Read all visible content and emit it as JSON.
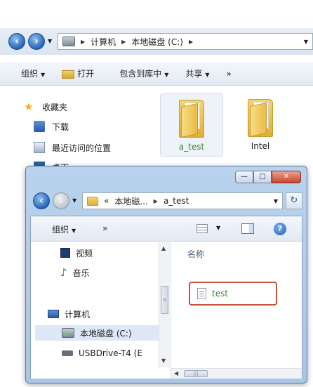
{
  "back_window": {
    "address": {
      "crumbs": [
        "计算机",
        "本地磁盘 (C:)"
      ]
    },
    "toolbar": {
      "organize": "组织",
      "open": "打开",
      "include_library": "包含到库中",
      "share": "共享",
      "more": "»"
    },
    "nav": {
      "favorites": "收藏夹",
      "downloads": "下载",
      "recent": "最近访问的位置",
      "desktop": "桌面"
    },
    "files": [
      {
        "name": "a_test",
        "selected": true
      },
      {
        "name": "Intel",
        "selected": false
      }
    ]
  },
  "front_window": {
    "caption": {
      "minimize": "—",
      "maximize": "□",
      "close": "✕"
    },
    "address": {
      "overflow": "«",
      "crumbs": [
        "本地磁...",
        "a_test"
      ],
      "refresh": "↻"
    },
    "toolbar": {
      "organize": "组织",
      "more": "»",
      "help": "?"
    },
    "nav": {
      "videos": "视频",
      "music": "音乐",
      "computer": "计算机",
      "local_disk": "本地磁盘 (C:)",
      "usb": "USBDrive-T4 (E"
    },
    "columns": {
      "name": "名称"
    },
    "files": [
      {
        "name": "test"
      }
    ],
    "scroll_h_thumb": "|||",
    "scroll_v_thumb": "≡"
  },
  "colors": {
    "highlight_border": "#c0553b",
    "file_label_green": "#2f8a2f"
  }
}
